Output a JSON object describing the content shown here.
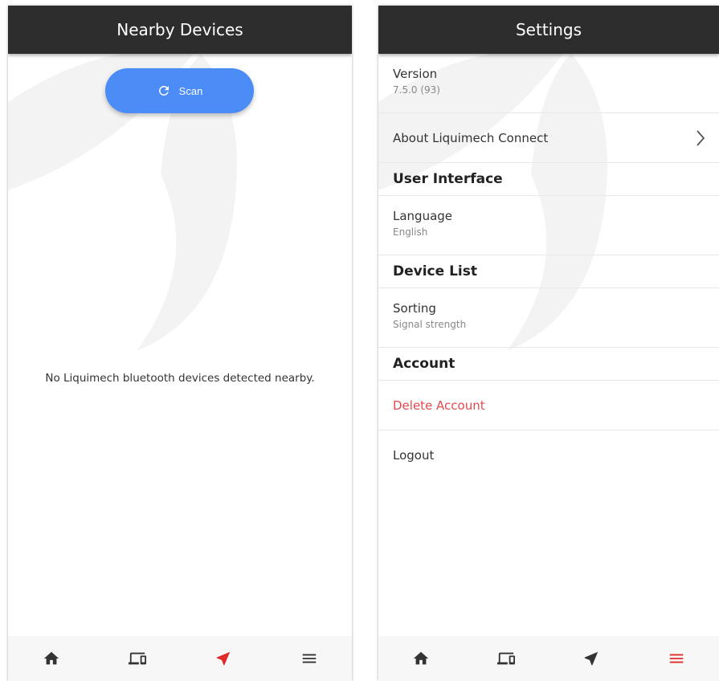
{
  "nearby": {
    "title": "Nearby Devices",
    "scan_label": "Scan",
    "empty_message": "No Liquimech bluetooth devices detected nearby."
  },
  "settings": {
    "title": "Settings",
    "version_label": "Version",
    "version_value": "7.5.0 (93)",
    "about_label": "About Liquimech Connect",
    "ui_header": "User Interface",
    "language_label": "Language",
    "language_value": "English",
    "device_list_header": "Device List",
    "sorting_label": "Sorting",
    "sorting_value": "Signal strength",
    "account_header": "Account",
    "delete_label": "Delete Account",
    "logout_label": "Logout"
  },
  "nav_icons": [
    "home-icon",
    "devices-icon",
    "navigation-icon",
    "menu-icon"
  ],
  "colors": {
    "app_bar": "#2d2d2d",
    "scan_button": "#4b8cf7",
    "active_nav": "#e02b2b",
    "inactive_nav": "#333333",
    "danger_text": "#e5484d"
  }
}
